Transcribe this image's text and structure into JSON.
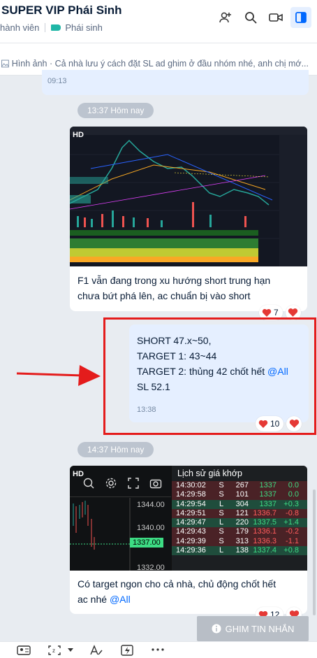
{
  "header": {
    "title": "SUPER VIP Phái Sinh",
    "member_label": "hành viên",
    "tag_label": "Phái sinh",
    "icons": [
      "add-member-icon",
      "search-icon",
      "video-call-icon",
      "sidebar-toggle-icon"
    ]
  },
  "pinned": {
    "text": "Hình ảnh · Cả nhà lưu ý cách đặt SL ad ghim ở đầu nhóm nhé, anh chị mớ..."
  },
  "messages": {
    "prev_time": "09:13",
    "date_chip_1": "13:37 Hôm nay",
    "chart_hd": "HD",
    "msg1_line1": "F1 vẫn đang trong xu hướng short trung hạn",
    "msg1_line2": "chưa bứt phá lên, ac chuẩn bị vào short",
    "msg1_reactions": "7",
    "msg2_line1": "SHORT 47.x~50,",
    "msg2_line2": "TARGET 1: 43~44",
    "msg2_line3_prefix": "TARGET 2: thủng 42 chốt hết ",
    "msg2_mention": "@All",
    "msg2_line4": "SL 52.1",
    "msg2_time": "13:38",
    "msg2_reactions": "10",
    "date_chip_2": "14:37 Hôm nay",
    "img2_hd": "HD",
    "price_ticks": [
      "1344.00",
      "1340.00",
      "1337.00",
      "1332.00"
    ],
    "trade_title": "Lịch sử giá khớp",
    "trades": [
      {
        "t": "14:30:02",
        "s": "S",
        "q": "267",
        "p": "1337",
        "c": "0.0",
        "type": "dn"
      },
      {
        "t": "14:29:58",
        "s": "S",
        "q": "101",
        "p": "1337",
        "c": "0.0",
        "type": "dn"
      },
      {
        "t": "14:29:54",
        "s": "L",
        "q": "304",
        "p": "1337",
        "c": "+0.3",
        "type": "up"
      },
      {
        "t": "14:29:51",
        "s": "S",
        "q": "121",
        "p": "1336.7",
        "c": "-0.8",
        "type": "dn"
      },
      {
        "t": "14:29:47",
        "s": "L",
        "q": "220",
        "p": "1337.5",
        "c": "+1.4",
        "type": "up"
      },
      {
        "t": "14:29:43",
        "s": "S",
        "q": "179",
        "p": "1336.1",
        "c": "-0.2",
        "type": "dn"
      },
      {
        "t": "14:29:39",
        "s": "S",
        "q": "313",
        "p": "1336.3",
        "c": "-1.1",
        "type": "dn"
      },
      {
        "t": "14:29:36",
        "s": "L",
        "q": "138",
        "p": "1337.4",
        "c": "+0.8",
        "type": "up"
      }
    ],
    "msg3_line1": "Có target ngon cho cả nhà, chủ động chốt hết",
    "msg3_line2_prefix": "ac nhé ",
    "msg3_mention": "@All",
    "msg3_reactions": "12"
  },
  "pin_button": "GHIM TIN NHẮN",
  "colors": {
    "accent": "#0068ff",
    "highlight": "#e41c1c",
    "up": "#3ddc84",
    "down": "#ff5c5c"
  }
}
